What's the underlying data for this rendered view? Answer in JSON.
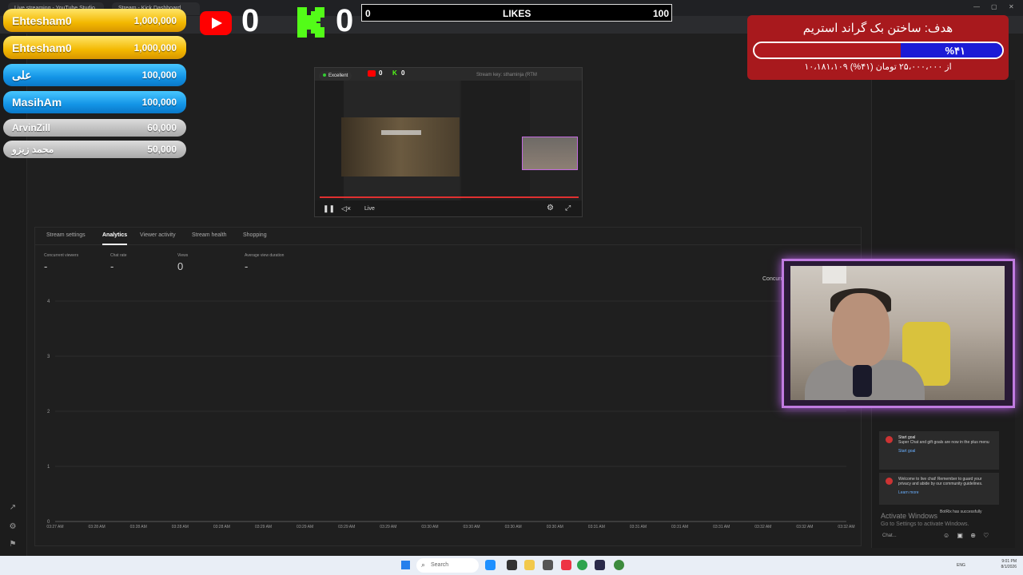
{
  "browser": {
    "tabs": [
      "Live streaming - YouTube Studio",
      "Stream - Kick Dashboard"
    ]
  },
  "leaderboard": [
    {
      "name": "Ehtesham0",
      "amount": "1,000,000",
      "tier": "gold"
    },
    {
      "name": "Ehtesham0",
      "amount": "1,000,000",
      "tier": "gold"
    },
    {
      "name": "علی",
      "amount": "100,000",
      "tier": "blue"
    },
    {
      "name": "MasihAm",
      "amount": "100,000",
      "tier": "blue"
    },
    {
      "name": "ArvinZill",
      "amount": "60,000",
      "tier": "grey"
    },
    {
      "name": "محمد زیزو",
      "amount": "50,000",
      "tier": "grey"
    }
  ],
  "counters": {
    "youtube": "0",
    "kick": "0"
  },
  "likes": {
    "current": "0",
    "label": "LIKES",
    "max": "100",
    "progress": 0
  },
  "goal": {
    "title": "هدف: ساختن بک گراند استریم",
    "percent_text": "%۴۱",
    "progress": 0.41,
    "subtitle": "۱۰،۱۸۱،۱۰۹ از ۲۵،۰۰۰،۰۰۰ تومان (۴۱%)"
  },
  "preview": {
    "quality": "Excellent",
    "yt_count": "0",
    "kick_count": "0",
    "live_label": "Live",
    "stream_key": "Stream key: sthaminja (RTM"
  },
  "analytics": {
    "tabs": [
      "Stream settings",
      "Analytics",
      "Viewer activity",
      "Stream health",
      "Shopping"
    ],
    "active_tab": "Analytics",
    "metrics": [
      {
        "label": "Concurrent viewers",
        "value": "-"
      },
      {
        "label": "Chat rate",
        "value": "-"
      },
      {
        "label": "Views",
        "value": "0"
      },
      {
        "label": "Average view duration",
        "value": "-"
      }
    ],
    "concurrent_label": "Concurr"
  },
  "chart_data": {
    "type": "line",
    "title": "",
    "xlabel": "",
    "ylabel": "",
    "ylim": [
      0,
      4
    ],
    "y_ticks": [
      "0",
      "1",
      "2",
      "3",
      "4"
    ],
    "x": [
      "03:27 AM",
      "03:28 AM",
      "03:28 AM",
      "03:28 AM",
      "03:28 AM",
      "03:29 AM",
      "03:29 AM",
      "03:29 AM",
      "03:29 AM",
      "03:30 AM",
      "03:30 AM",
      "03:30 AM",
      "03:30 AM",
      "03:31 AM",
      "03:31 AM",
      "03:31 AM",
      "03:31 AM",
      "03:32 AM",
      "03:32 AM",
      "03:32 AM"
    ],
    "series": [
      {
        "values": [
          0,
          0,
          0,
          0,
          0,
          0,
          0,
          0,
          0,
          0,
          0,
          0,
          0,
          0,
          0,
          0,
          0,
          0,
          0,
          0
        ]
      }
    ],
    "grid": true
  },
  "chat": {
    "cards": [
      {
        "title": "Start goal",
        "body": "Super Chat and gift goals are now in the plus menu",
        "link": "Start goal"
      },
      {
        "title": "",
        "body": "Welcome to live chat! Remember to guard your privacy and abide by our community guidelines.",
        "link": "Learn more"
      }
    ],
    "line": "BotRix has successfully",
    "input_placeholder": "Chat...",
    "watermark_title": "Activate Windows",
    "watermark_sub": "Go to Settings to activate Windows."
  },
  "taskbar": {
    "search": "Search",
    "lang": "ENG",
    "time": "9:01 PM",
    "date": "8/1/2026"
  },
  "colors": {
    "gold": "#f3b800",
    "blue": "#1394e6",
    "grey": "#a9a9a9",
    "goal_red": "#a8191d",
    "goal_blue": "#1b1bd6",
    "youtube": "#ff0000",
    "kick": "#53fc18"
  }
}
